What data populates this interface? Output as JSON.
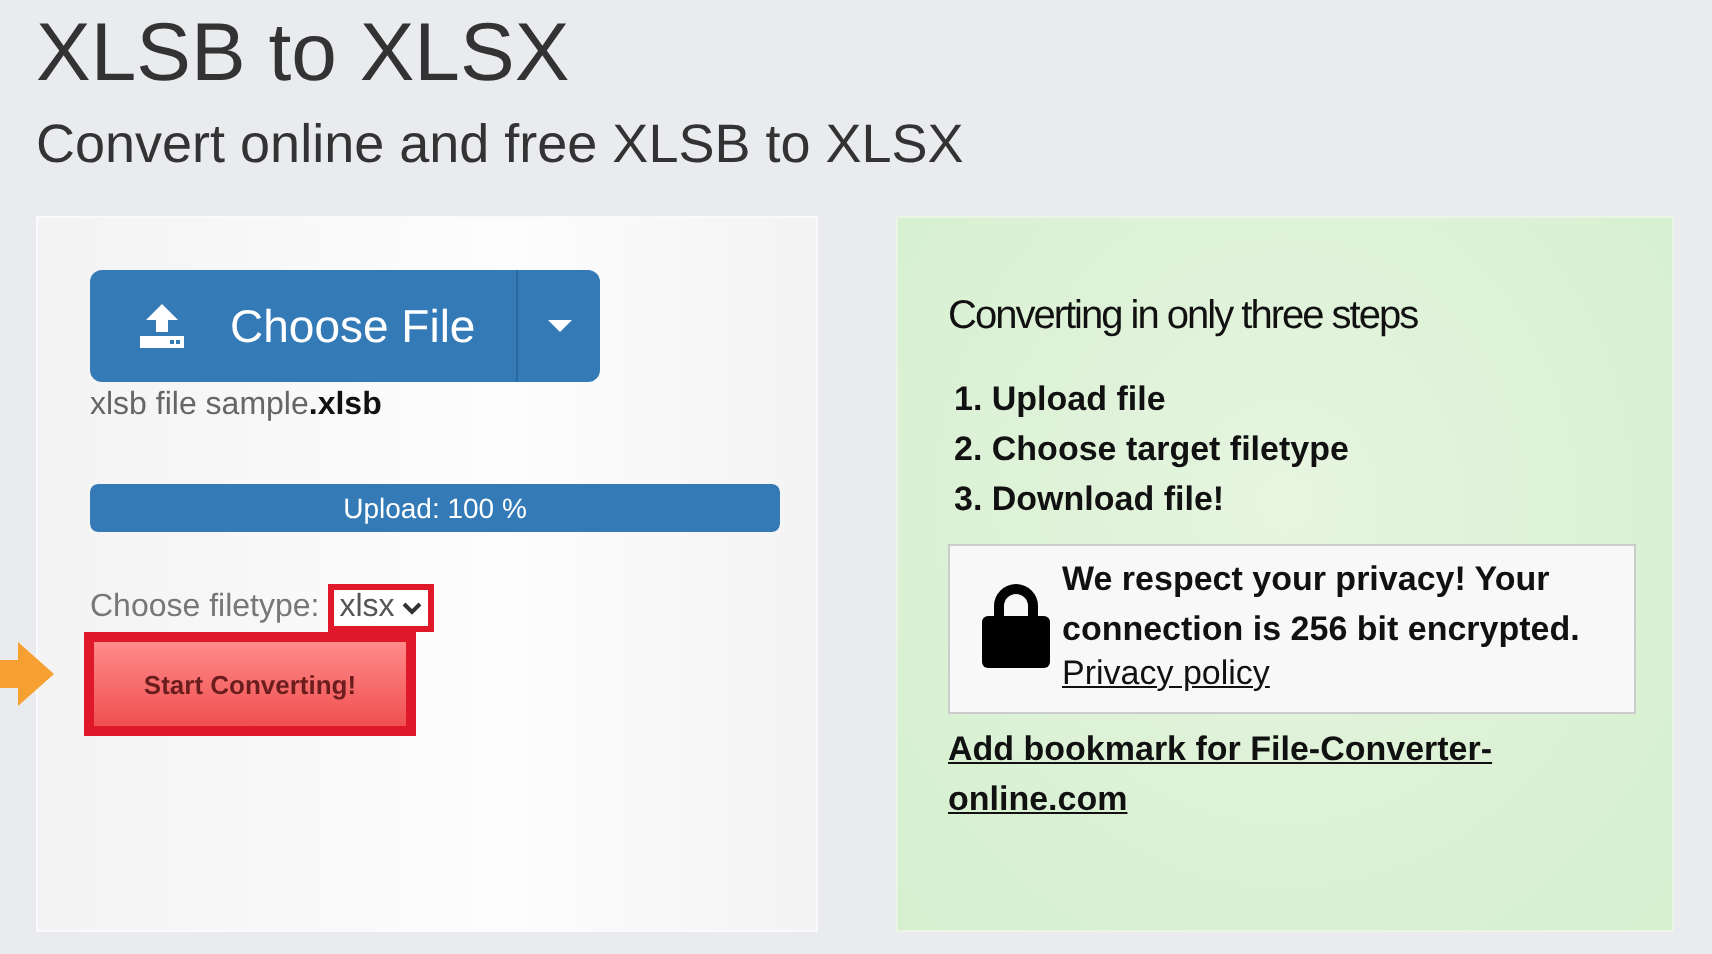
{
  "title": "XLSB to XLSX",
  "subtitle": "Convert online and free XLSB to XLSX",
  "converter": {
    "choose_button": "Choose File",
    "file_name": "xlsb file sample**.xlsb**",
    "upload": {
      "label": "Upload: 100 %",
      "level": 1
    },
    "filetype_label": "Choose filetype:",
    "filetype": {
      "value": "xlsx",
      "highlighted": true
    },
    "start_button": {
      "label": "Start Converting!",
      "highlighted": true,
      "pointer_arrow": true
    }
  },
  "steps_panel": {
    "heading": "Converting in only three steps",
    "steps": [
      "1. Upload file",
      "2. Choose target filetype",
      "3. Download file!"
    ],
    "privacy": {
      "text": "We respect your privacy! Your connection is 256 bit encrypted.",
      "link": "Privacy policy"
    },
    "bookmark_link": "Add bookmark for File-Converter-online.com"
  }
}
